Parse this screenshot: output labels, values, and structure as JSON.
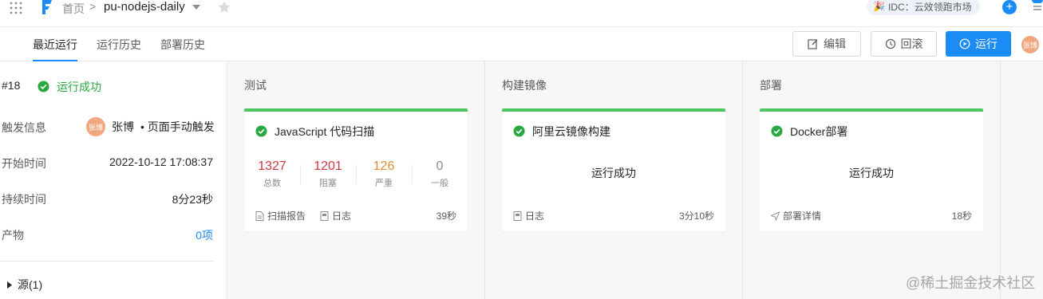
{
  "breadcrumb": {
    "home": "首页",
    "separator": ">",
    "project": "pu-nodejs-daily"
  },
  "topbar": {
    "idc_badge": "IDC：云效领跑市场",
    "idc_emoji": "🎉",
    "plus": "+"
  },
  "tabs": [
    {
      "label": "最近运行",
      "active": true
    },
    {
      "label": "运行历史",
      "active": false
    },
    {
      "label": "部署历史",
      "active": false
    }
  ],
  "actions": {
    "edit": "编辑",
    "rollback": "回滚",
    "run": "运行"
  },
  "avatar_text": "张博",
  "run": {
    "number": "#18",
    "status": "运行成功",
    "rows": [
      {
        "label": "触发信息",
        "user": "张博",
        "value": "• 页面手动触发"
      },
      {
        "label": "开始时间",
        "value": "2022-10-12 17:08:37"
      },
      {
        "label": "持续时间",
        "value": "8分23秒"
      },
      {
        "label": "产物",
        "value": "0项"
      }
    ],
    "source": "源(1)"
  },
  "stages": [
    {
      "title": "测试",
      "job": {
        "name": "JavaScript 代码扫描",
        "metrics": [
          {
            "value": "1327",
            "label": "总数",
            "color": "#d4373f"
          },
          {
            "value": "1201",
            "label": "阻塞",
            "color": "#d4373f"
          },
          {
            "value": "126",
            "label": "严重",
            "color": "#e58a2f"
          },
          {
            "value": "0",
            "label": "一般",
            "color": "#8c8c8c"
          }
        ],
        "links": [
          "扫描报告",
          "日志"
        ],
        "duration": "39秒"
      }
    },
    {
      "title": "构建镜像",
      "job": {
        "name": "阿里云镜像构建",
        "result": "运行成功",
        "links": [
          "日志"
        ],
        "duration": "3分10秒"
      }
    },
    {
      "title": "部署",
      "job": {
        "name": "Docker部署",
        "result": "运行成功",
        "links": [
          "部署详情"
        ],
        "duration": "18秒"
      }
    }
  ],
  "colors": {
    "accent": "#1b8cf5",
    "success": "#4cc764",
    "danger": "#d4373f",
    "warning": "#e58a2f"
  },
  "watermark": "@稀土掘金技术社区"
}
